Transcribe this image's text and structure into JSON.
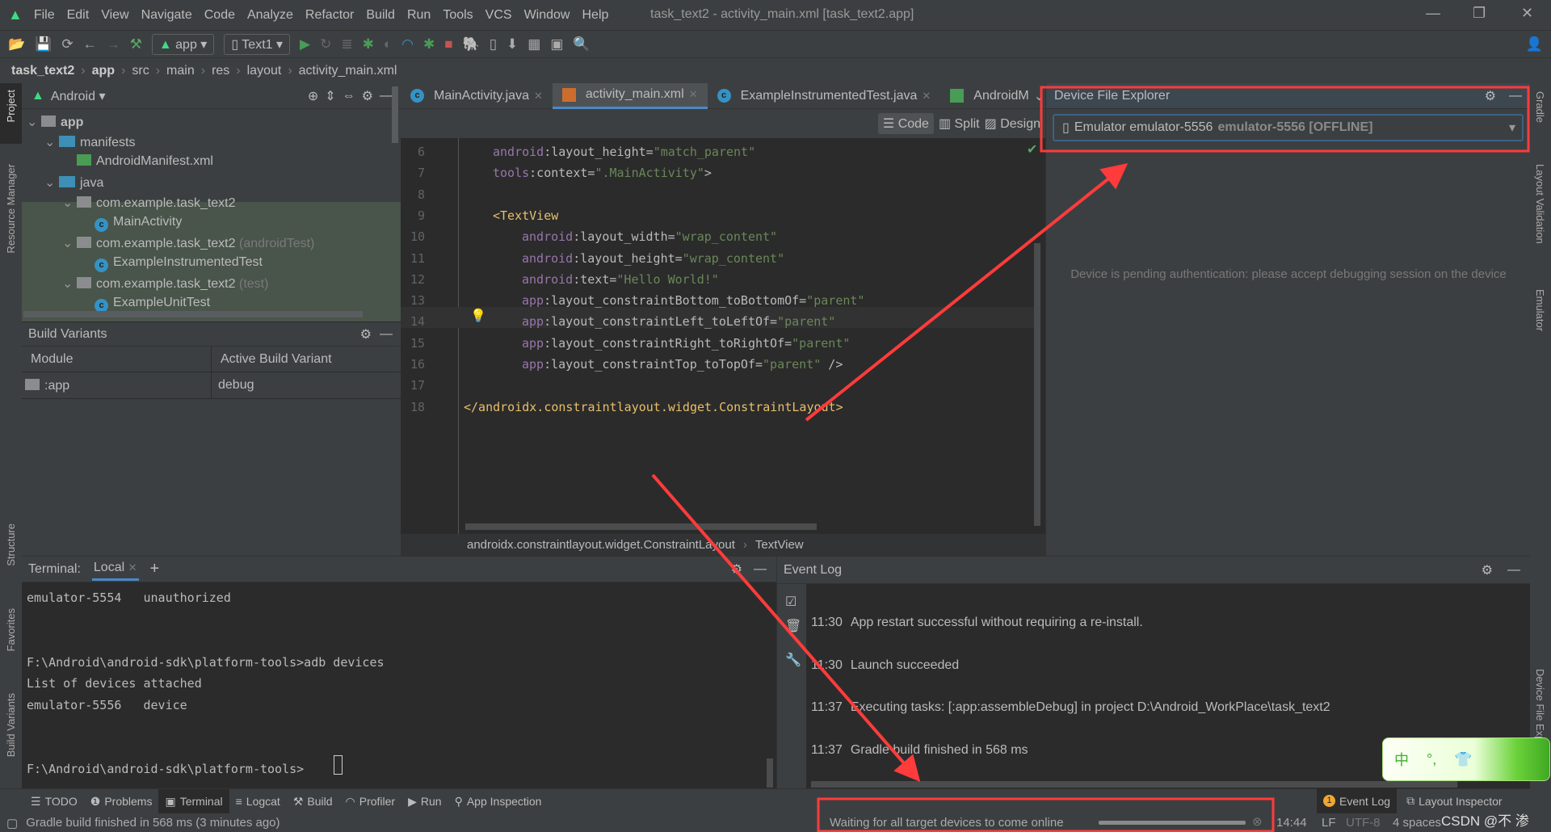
{
  "window": {
    "title": "task_text2 - activity_main.xml [task_text2.app]",
    "controls": [
      "—",
      "❐",
      "✕"
    ]
  },
  "menu": [
    "File",
    "Edit",
    "View",
    "Navigate",
    "Code",
    "Analyze",
    "Refactor",
    "Build",
    "Run",
    "Tools",
    "VCS",
    "Window",
    "Help"
  ],
  "toolbar": {
    "run_config": "app",
    "device": "Text1"
  },
  "breadcrumb": [
    "task_text2",
    "app",
    "src",
    "main",
    "res",
    "layout",
    "activity_main.xml"
  ],
  "left_stripe": {
    "project": "Project",
    "resource_manager": "Resource Manager",
    "structure": "Structure",
    "favorites": "Favorites",
    "build_variants": "Build Variants"
  },
  "right_stripe": {
    "gradle": "Gradle",
    "layout_validation": "Layout Validation",
    "emulator": "Emulator",
    "device_file_explorer": "Device File Explorer"
  },
  "project": {
    "view": "Android",
    "tree": [
      {
        "label": "app",
        "bold": true
      },
      {
        "label": "manifests"
      },
      {
        "label": "AndroidManifest.xml"
      },
      {
        "label": "java"
      },
      {
        "label": "com.example.task_text2"
      },
      {
        "label": "MainActivity"
      },
      {
        "label": "com.example.task_text2",
        "suffix": "(androidTest)"
      },
      {
        "label": "ExampleInstrumentedTest"
      },
      {
        "label": "com.example.task_text2",
        "suffix": "(test)"
      },
      {
        "label": "ExampleUnitTest"
      }
    ]
  },
  "build_variants": {
    "title": "Build Variants",
    "columns": [
      "Module",
      "Active Build Variant"
    ],
    "rows": [
      {
        "module": ":app",
        "variant": "debug"
      }
    ]
  },
  "editor": {
    "tabs": [
      {
        "label": "MainActivity.java"
      },
      {
        "label": "activity_main.xml",
        "active": true
      },
      {
        "label": "ExampleInstrumentedTest.java"
      },
      {
        "label": "AndroidM"
      }
    ],
    "modes": [
      "Code",
      "Split",
      "Design"
    ],
    "lines": [
      {
        "n": "6",
        "ns": "android",
        "attr": ":layout_height=",
        "val": "\"match_parent\"",
        "indent": 1
      },
      {
        "n": "7",
        "ns": "tools",
        "attr": ":context=",
        "val": "\".MainActivity\"",
        "tail": ">",
        "indent": 1
      },
      {
        "n": "8"
      },
      {
        "n": "9",
        "tag": "<TextView",
        "indent": 1
      },
      {
        "n": "10",
        "ns": "android",
        "attr": ":layout_width=",
        "val": "\"wrap_content\"",
        "indent": 2
      },
      {
        "n": "11",
        "ns": "android",
        "attr": ":layout_height=",
        "val": "\"wrap_content\"",
        "indent": 2
      },
      {
        "n": "12",
        "ns": "android",
        "attr": ":text=",
        "val": "\"Hello World!\"",
        "indent": 2
      },
      {
        "n": "13",
        "ns": "app",
        "attr": ":layout_constraintBottom_toBottomOf=",
        "val": "\"parent\"",
        "indent": 2
      },
      {
        "n": "14",
        "ns": "app",
        "attr": ":layout_constraintLeft_toLeftOf=",
        "val": "\"parent\"",
        "indent": 2
      },
      {
        "n": "15",
        "ns": "app",
        "attr": ":layout_constraintRight_toRightOf=",
        "val": "\"parent\"",
        "indent": 2
      },
      {
        "n": "16",
        "ns": "app",
        "attr": ":layout_constraintTop_toTopOf=",
        "val": "\"parent\"",
        "tail": " />",
        "indent": 2
      },
      {
        "n": "17"
      },
      {
        "n": "18",
        "tag": "</androidx.constraintlayout.widget.ConstraintLayout>",
        "indent": 0
      }
    ],
    "path": [
      "androidx.constraintlayout.widget.ConstraintLayout",
      "TextView"
    ]
  },
  "device_explorer": {
    "title": "Device File Explorer",
    "device": "Emulator emulator-5556",
    "device_status": "emulator-5556 [OFFLINE]",
    "message": "Device is pending authentication: please accept debugging session on the device"
  },
  "terminal": {
    "label": "Terminal:",
    "tab": "Local",
    "lines": [
      "emulator-5554   unauthorized",
      "",
      "",
      "F:\\Android\\android-sdk\\platform-tools>adb devices",
      "List of devices attached",
      "emulator-5556   device",
      "",
      "",
      "F:\\Android\\android-sdk\\platform-tools>"
    ]
  },
  "event_log": {
    "title": "Event Log",
    "entries": [
      {
        "time": "11:30",
        "text": "App restart successful without requiring a re-install."
      },
      {
        "time": "11:30",
        "text": "Launch succeeded"
      },
      {
        "time": "11:37",
        "text": "Executing tasks: [:app:assembleDebug] in project D:\\Android_WorkPlace\\task_text2"
      },
      {
        "time": "11:37",
        "text": "Gradle build finished in 568 ms"
      }
    ]
  },
  "tool_windows": [
    "TODO",
    "Problems",
    "Terminal",
    "Logcat",
    "Build",
    "Profiler",
    "Run",
    "App Inspection"
  ],
  "tool_windows_right": [
    "Event Log",
    "Layout Inspector"
  ],
  "event_badge": "1",
  "ime": {
    "chars": [
      "中",
      "°,",
      "👕"
    ]
  },
  "status": {
    "message": "Gradle build finished in 568 ms (3 minutes ago)",
    "progress_text": "Waiting for all target devices to come online",
    "progress": 0.0,
    "time": "14:44",
    "line_sep": "LF",
    "encoding": "UTF-8",
    "indent": "4 spaces",
    "watermark": "CSDN @不 渗"
  },
  "colors": {
    "annotation": "#ff3b3b",
    "accent": "#4a88c7"
  }
}
